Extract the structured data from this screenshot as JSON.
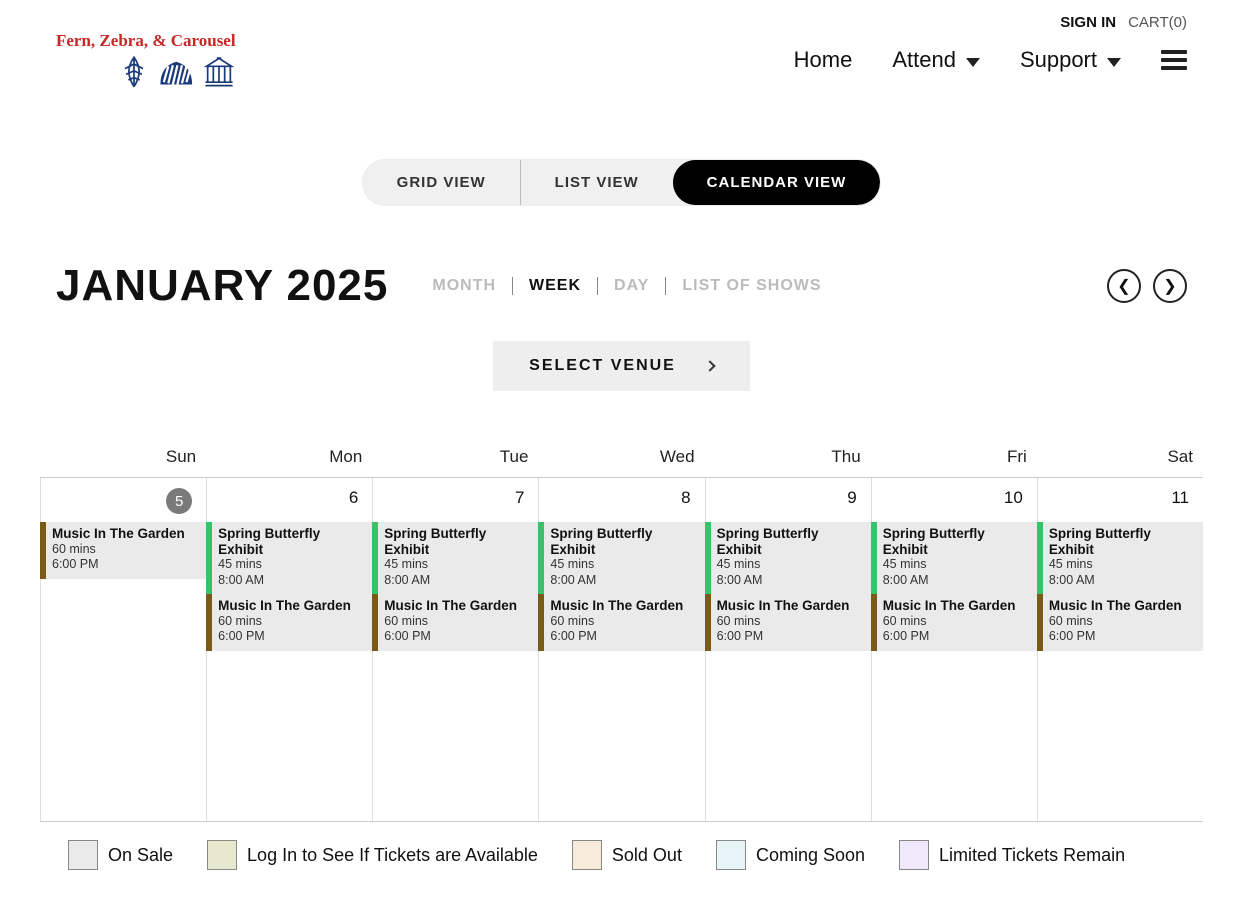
{
  "topbar": {
    "sign_in": "SIGN IN",
    "cart_label": "CART(0)"
  },
  "brand": {
    "line": "Fern, Zebra, & Carousel"
  },
  "nav": {
    "home": "Home",
    "attend": "Attend",
    "support": "Support"
  },
  "view_tabs": {
    "grid": "GRID VIEW",
    "list": "LIST VIEW",
    "calendar": "CALENDAR VIEW"
  },
  "title": "JANUARY 2025",
  "range_tabs": {
    "month": "MONTH",
    "week": "WEEK",
    "day": "DAY",
    "list": "LIST OF SHOWS"
  },
  "venue_button": "SELECT VENUE",
  "day_names": [
    "Sun",
    "Mon",
    "Tue",
    "Wed",
    "Thu",
    "Fri",
    "Sat"
  ],
  "dates": [
    "5",
    "6",
    "7",
    "8",
    "9",
    "10",
    "11"
  ],
  "today_index": 0,
  "events_row1": [
    {
      "title": "Music In The Garden",
      "duration": "60 mins",
      "time": "6:00 PM",
      "color": "brown"
    },
    {
      "title": "Spring Butterfly Exhibit",
      "duration": "45 mins",
      "time": "8:00 AM",
      "color": "green"
    },
    {
      "title": "Spring Butterfly Exhibit",
      "duration": "45 mins",
      "time": "8:00 AM",
      "color": "green"
    },
    {
      "title": "Spring Butterfly Exhibit",
      "duration": "45 mins",
      "time": "8:00 AM",
      "color": "green"
    },
    {
      "title": "Spring Butterfly Exhibit",
      "duration": "45 mins",
      "time": "8:00 AM",
      "color": "green"
    },
    {
      "title": "Spring Butterfly Exhibit",
      "duration": "45 mins",
      "time": "8:00 AM",
      "color": "green"
    },
    {
      "title": "Spring Butterfly Exhibit",
      "duration": "45 mins",
      "time": "8:00 AM",
      "color": "green"
    }
  ],
  "events_row2": [
    null,
    {
      "title": "Music In The Garden",
      "duration": "60 mins",
      "time": "6:00 PM",
      "color": "brown"
    },
    {
      "title": "Music In The Garden",
      "duration": "60 mins",
      "time": "6:00 PM",
      "color": "brown"
    },
    {
      "title": "Music In The Garden",
      "duration": "60 mins",
      "time": "6:00 PM",
      "color": "brown"
    },
    {
      "title": "Music In The Garden",
      "duration": "60 mins",
      "time": "6:00 PM",
      "color": "brown"
    },
    {
      "title": "Music In The Garden",
      "duration": "60 mins",
      "time": "6:00 PM",
      "color": "brown"
    },
    {
      "title": "Music In The Garden",
      "duration": "60 mins",
      "time": "6:00 PM",
      "color": "brown"
    }
  ],
  "legend": {
    "on_sale": "On Sale",
    "login": "Log In to See If Tickets are Available",
    "sold_out": "Sold Out",
    "coming_soon": "Coming Soon",
    "limited": "Limited Tickets Remain"
  }
}
